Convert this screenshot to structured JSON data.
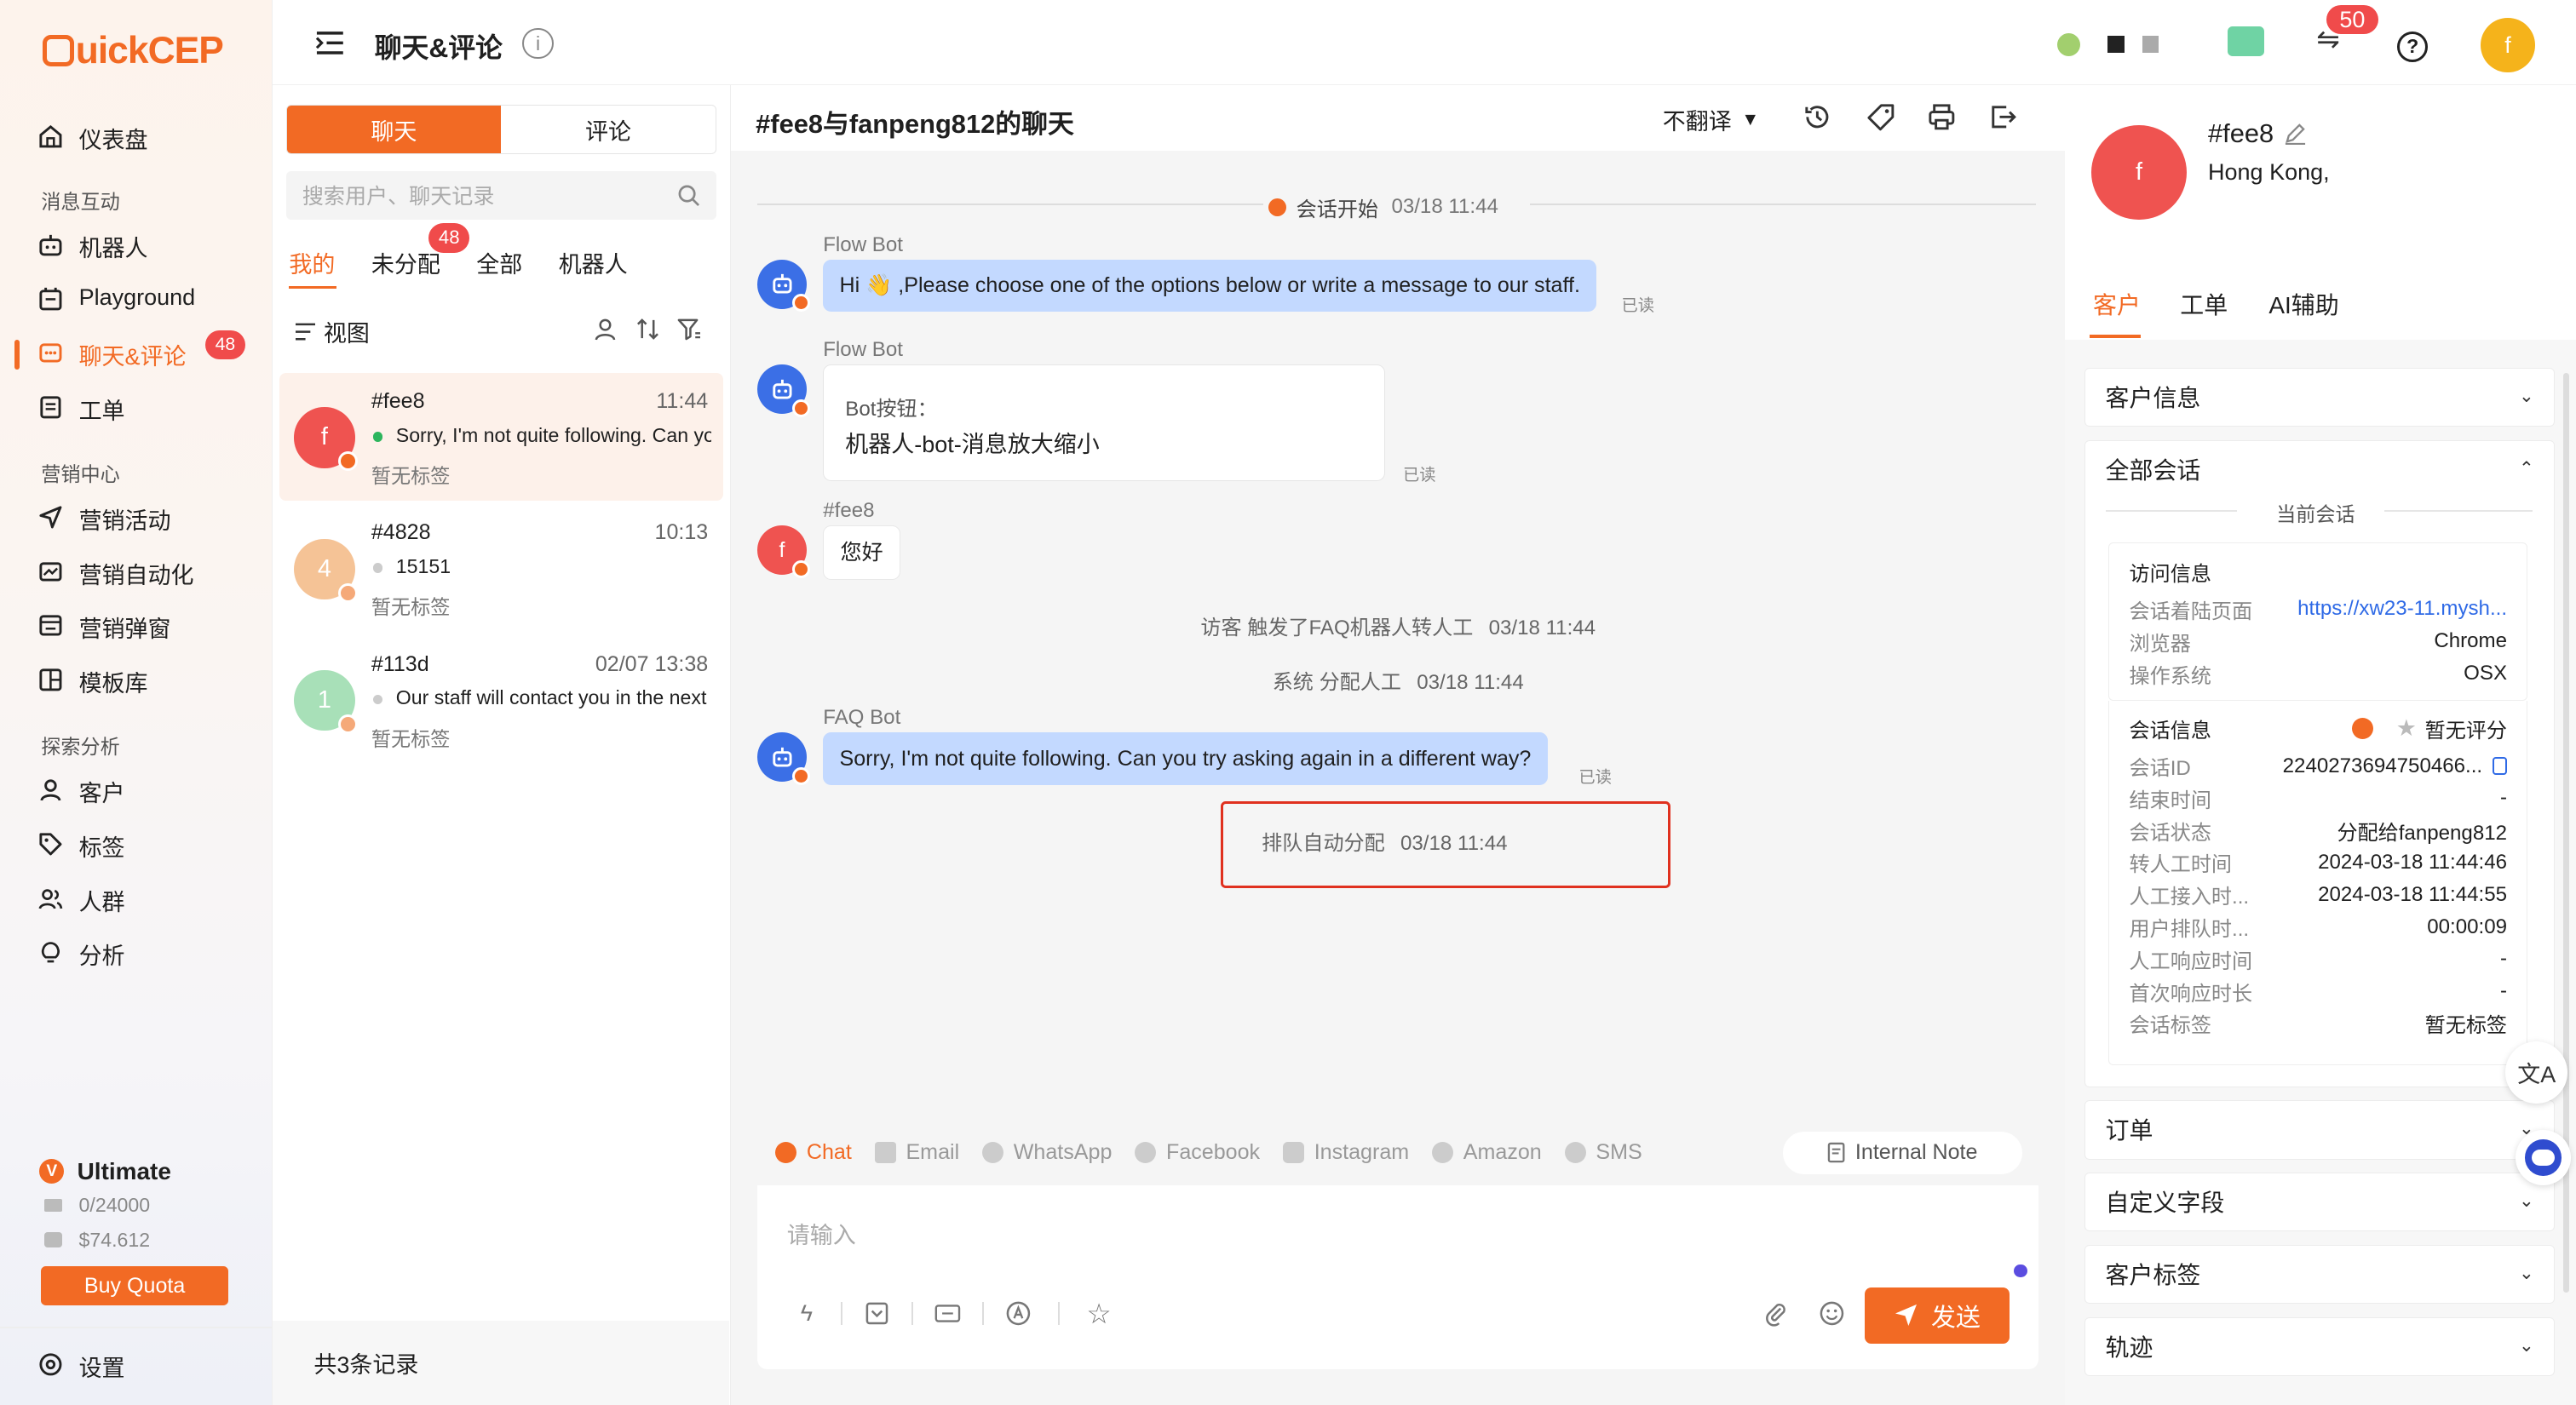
{
  "app": {
    "logo": "QuickCEP",
    "brand_color": "#f26a24"
  },
  "sidebar": {
    "items": [
      {
        "label": "仪表盘",
        "icon": "home-icon"
      },
      {
        "section": "消息互动"
      },
      {
        "label": "机器人",
        "icon": "bot-icon"
      },
      {
        "label": "Playground",
        "icon": "playground-icon"
      },
      {
        "label": "聊天&评论",
        "icon": "chat-icon",
        "badge": "48",
        "active": true
      },
      {
        "label": "工单",
        "icon": "ticket-icon"
      },
      {
        "section": "营销中心"
      },
      {
        "label": "营销活动",
        "icon": "send-icon"
      },
      {
        "label": "营销自动化",
        "icon": "automation-icon"
      },
      {
        "label": "营销弹窗",
        "icon": "popup-icon"
      },
      {
        "label": "模板库",
        "icon": "template-icon"
      },
      {
        "section": "探索分析"
      },
      {
        "label": "客户",
        "icon": "user-icon"
      },
      {
        "label": "标签",
        "icon": "tag-icon"
      },
      {
        "label": "人群",
        "icon": "group-icon"
      },
      {
        "label": "分析",
        "icon": "bulb-icon"
      }
    ],
    "plan": "Ultimate",
    "quota": "0/24000",
    "balance": "$74.612",
    "buy_quota": "Buy Quota",
    "settings": "设置"
  },
  "header": {
    "title": "聊天&评论",
    "notification_count": "50",
    "user_initial": "f"
  },
  "conv_list": {
    "tab_chat": "聊天",
    "tab_comment": "评论",
    "search_placeholder": "搜索用户、聊天记录",
    "filters": [
      {
        "label": "我的"
      },
      {
        "label": "未分配",
        "badge": "48"
      },
      {
        "label": "全部"
      },
      {
        "label": "机器人"
      }
    ],
    "view_label": "视图",
    "items": [
      {
        "initial": "f",
        "name": "#fee8",
        "time": "11:44",
        "preview": "Sorry, I'm not quite following. Can you try asking again in a different way?",
        "tag": "暂无标签",
        "color": "#ef5350",
        "dot": "#2db55d"
      },
      {
        "initial": "4",
        "name": "#4828",
        "time": "10:13",
        "preview": "15151",
        "tag": "暂无标签",
        "color": "#f5c396",
        "dot": "#ccc"
      },
      {
        "initial": "1",
        "name": "#113d",
        "time": "02/07 13:38",
        "preview": "Our staff will contact you in the next few minutes",
        "tag": "暂无标签",
        "color": "#a8e0b8",
        "dot": "#ccc"
      }
    ],
    "total": "共3条记录"
  },
  "chat": {
    "title": "#fee8与fanpeng812的聊天",
    "translate": "不翻译",
    "session_start": "会话开始",
    "session_start_time": "03/18 11:44",
    "messages": [
      {
        "sender": "Flow Bot",
        "text": "Hi 👋 ,Please choose one of the options below or write a message to our staff.",
        "read": "已读"
      },
      {
        "sender": "Flow Bot",
        "button_label": "Bot按钮：",
        "button_text": "机器人-bot-消息放大缩小",
        "read": "已读"
      },
      {
        "sender": "#fee8",
        "text": "您好"
      },
      {
        "system": "访客 触发了FAQ机器人转人工",
        "time": "03/18 11:44"
      },
      {
        "system": "系统 分配人工",
        "time": "03/18 11:44"
      },
      {
        "sender": "FAQ Bot",
        "text": "Sorry, I'm not quite following. Can you try asking again in a different way?",
        "read": "已读"
      },
      {
        "system": "排队自动分配",
        "time": "03/18 11:44"
      }
    ],
    "channels": [
      "Chat",
      "Email",
      "WhatsApp",
      "Facebook",
      "Instagram",
      "Amazon",
      "SMS"
    ],
    "internal_note": "Internal Note",
    "input_placeholder": "请输入",
    "send": "发送",
    "highlight_color": "#e0311f"
  },
  "customer": {
    "initial": "f",
    "name": "#fee8",
    "location": "Hong Kong,",
    "tabs": [
      "客户",
      "工单",
      "AI辅助"
    ],
    "sections": {
      "customer_info": "客户信息",
      "all_sessions": "全部会话",
      "current_session": "当前会话",
      "visit_info": "访问信息",
      "visit_rows": [
        {
          "k": "会话着陆页面",
          "v": "https://xw23-11.mysh..."
        },
        {
          "k": "浏览器",
          "v": "Chrome"
        },
        {
          "k": "操作系统",
          "v": "OSX"
        }
      ],
      "session_info": "会话信息",
      "rating": "暂无评分",
      "session_rows": [
        {
          "k": "会话ID",
          "v": "2240273694750466..."
        },
        {
          "k": "结束时间",
          "v": "-"
        },
        {
          "k": "会话状态",
          "v": "分配给fanpeng812"
        },
        {
          "k": "转人工时间",
          "v": "2024-03-18 11:44:46"
        },
        {
          "k": "人工接入时...",
          "v": "2024-03-18 11:44:55"
        },
        {
          "k": "用户排队时...",
          "v": "00:00:09"
        },
        {
          "k": "人工响应时间",
          "v": "-"
        },
        {
          "k": "首次响应时长",
          "v": "-"
        },
        {
          "k": "会话标签",
          "v": "暂无标签"
        }
      ],
      "orders": "订单",
      "custom_fields": "自定义字段",
      "customer_tags": "客户标签",
      "trail": "轨迹"
    }
  }
}
